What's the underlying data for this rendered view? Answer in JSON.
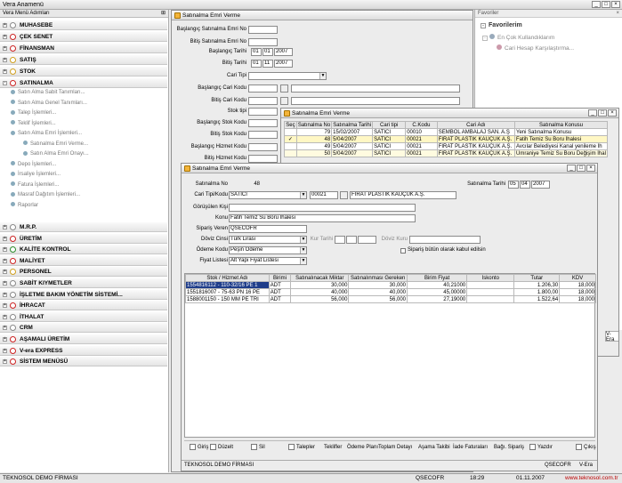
{
  "app": {
    "title": "Vera Anamenü"
  },
  "left_panel": {
    "title": "Vera Menü Adımları"
  },
  "menu_groups_top": [
    {
      "label": "MUHASEBE",
      "color": "#888888"
    },
    {
      "label": "ÇEK SENET",
      "color": "#cc2222"
    },
    {
      "label": "FİNANSMAN",
      "color": "#cc2222"
    },
    {
      "label": "SATIŞ",
      "color": "#d0a020"
    },
    {
      "label": "STOK",
      "color": "#d0a020"
    },
    {
      "label": "SATINALMA",
      "color": "#cc2222"
    }
  ],
  "satinalma_items": [
    "Satın Alma Sabit Tanımları...",
    "Satın Alma Genel Tanımları...",
    "Talep İşlemleri...",
    "Teklif İşlemleri...",
    "Satın Alma Emri İşlemleri...",
    "Satınalma Emri Verme...",
    "Satın Alma Emri Onayı...",
    "Depo İşlemleri...",
    "İrsaliye İşlemleri...",
    "Fatura İşlemleri...",
    "Masraf Dağıtım İşlemleri...",
    "Raporlar"
  ],
  "menu_groups_bottom": [
    {
      "label": "M.R.P.",
      "color": "#888888"
    },
    {
      "label": "ÜRETİM",
      "color": "#cc2222"
    },
    {
      "label": "KALİTE KONTROL",
      "color": "#2a8a2a"
    },
    {
      "label": "MALİYET",
      "color": "#cc2222"
    },
    {
      "label": "PERSONEL",
      "color": "#d0a020"
    },
    {
      "label": "SABİT KIYMETLER",
      "color": "#888888"
    },
    {
      "label": "İŞLETME BAKIM YÖNETİM SİSTEMİ...",
      "color": "#888888"
    },
    {
      "label": "İHRACAT",
      "color": "#cc2222"
    },
    {
      "label": "İTHALAT",
      "color": "#888888"
    },
    {
      "label": "CRM",
      "color": "#888888"
    },
    {
      "label": "AŞAMALI ÜRETİM",
      "color": "#cc2222"
    },
    {
      "label": "V-era EXPRESS",
      "color": "#cc2222"
    },
    {
      "label": "SİSTEM MENÜSÜ",
      "color": "#cc2222"
    }
  ],
  "favorites": {
    "title": "Favoriler",
    "root": "Favorilerim",
    "group": "En Çok Kullandıklarım",
    "item": "Cari Hesap Karşılaştırma..."
  },
  "filter_window": {
    "title": "Satınalma Emri Verme",
    "labels": [
      "Başlangıç Satınalma Emri No",
      "Bitiş Satınalma Emri No",
      "Başlangıç Tarihi",
      "Bitiş Tarihi",
      "Cari Tipi",
      "Başlangıç Cari Kodu",
      "Bitiş Cari Kodu",
      "Stok tipi",
      "Başlangıç Stok Kodu",
      "Bitiş Stok Kodu",
      "Başlangıç Hizmet Kodu",
      "Bitiş Hizmet Kodu"
    ],
    "start_date": {
      "d": "01",
      "m": "01",
      "y": "2007"
    },
    "end_date": {
      "d": "01",
      "m": "11",
      "y": "2007"
    }
  },
  "list_window": {
    "title": "Satınalma Emri Verme",
    "columns": [
      "Seç",
      "Satınalma No",
      "Satınalma Tarihi",
      "Cari tipi",
      "C.Kodu",
      "Cari Adı",
      "Satınalma Konusu"
    ],
    "rows": [
      {
        "sec": "",
        "no": "79",
        "tarih": "15/02/2007",
        "tip": "SATICI",
        "kod": "00010",
        "ad": "SEMBOL AMBALAJ SAN. A.Ş",
        "konu": "Yeni Satınalma Konusu"
      },
      {
        "sec": "✓",
        "no": "48",
        "tarih": "5/04/2007",
        "tip": "SATICI",
        "kod": "00021",
        "ad": "FIRAT PLASTİK KAUÇUK A.Ş.",
        "konu": "Fatih Temiz Su Boru İhalesi"
      },
      {
        "sec": "",
        "no": "49",
        "tarih": "5/04/2007",
        "tip": "SATICI",
        "kod": "00021",
        "ad": "FIRAT PLASTİK KAUÇUK A.Ş.",
        "konu": "Avcılar Belediyesi Kanal yenileme İh"
      },
      {
        "sec": "",
        "no": "50",
        "tarih": "5/04/2007",
        "tip": "SATICI",
        "kod": "00021",
        "ad": "FIRAT PLASTİK KAUÇUK A.Ş.",
        "konu": "Ümraniye Temiz Su Boru Değişim İhal"
      }
    ]
  },
  "detail_window": {
    "title": "Satınalma Emri Verme",
    "no_label": "Satınalma No",
    "no_value": "48",
    "date_label": "Satınalma Tarihi",
    "date": {
      "d": "05",
      "m": "04",
      "y": "2007"
    },
    "cari_label": "Cari Tipi/Kodu",
    "cari_tip": "SATICI",
    "cari_kod": "00021",
    "cari_ad": "FIRAT PLASTİK KAUÇUK A.Ş.",
    "gorusulen_label": "Görüşülen Kişi",
    "konu_label": "Konu",
    "konu": "Fatih Temiz Su Boru İhalesi",
    "siparis_veren_label": "Sipariş Veren",
    "siparis_veren": "QSECOFR",
    "doviz_label": "Döviz Cinsi",
    "doviz": "Türk Lirası",
    "kur_tarihi_label": "Kur Tarihi",
    "doviz_kuru_label": "Döviz Kuru",
    "odeme_label": "Ödeme Kodu",
    "odeme": "Peşin Ödeme",
    "fiyat_label": "Fiyat Listesi",
    "fiyat": "Alt Yapı Fiyat Listesi",
    "checkbox_label": "Sipariş bütün olarak kabul edilsin",
    "columns": [
      "Stok / Hizmet Adı",
      "Birimi",
      "Satınalınacak Miktar",
      "Satınalınması Gereken",
      "Birim Fiyat",
      "İskonto",
      "Tutar",
      "KDV"
    ],
    "rows": [
      {
        "ad": "1554816112 - 110-32/16 PE 1",
        "birim": "ADT",
        "miktar": "30,000",
        "gereken": "30,000",
        "fiyat": "40,21000",
        "iskonto": "",
        "tutar": "1.206,30",
        "kdv": "18,000"
      },
      {
        "ad": "1551816007 - 75-63 PN 16 PE",
        "birim": "ADT",
        "miktar": "40,000",
        "gereken": "40,000",
        "fiyat": "45,00000",
        "iskonto": "",
        "tutar": "1.800,00",
        "kdv": "18,000"
      },
      {
        "ad": "1588001150 - 150 MM PE TRI",
        "birim": "ADT",
        "miktar": "56,000",
        "gereken": "56,000",
        "fiyat": "27,19000",
        "iskonto": "",
        "tutar": "1.522,64",
        "kdv": "18,000"
      }
    ],
    "toolbar": [
      "Giriş",
      "Düzelt",
      "Sil",
      "Talepler",
      "Teklifler",
      "Ödeme Planı",
      "Toplam Detayı",
      "Aşama Takibi",
      "İade Faturaları",
      "Bağı. Sipariş",
      "Yazdır",
      "Çıkış"
    ],
    "status_left": "TEKNOSOL DEMO FİRMASI",
    "status_user": "QSECOFR",
    "status_app": "V-Era"
  },
  "list_side": {
    "status_app": "V-Era"
  },
  "status_bar": {
    "company": "TEKNOSOL DEMO FİRMASI",
    "user": "QSECOFR",
    "time": "18:29",
    "date": "01.11.2007",
    "site": "www.teknosol.com.tr"
  }
}
